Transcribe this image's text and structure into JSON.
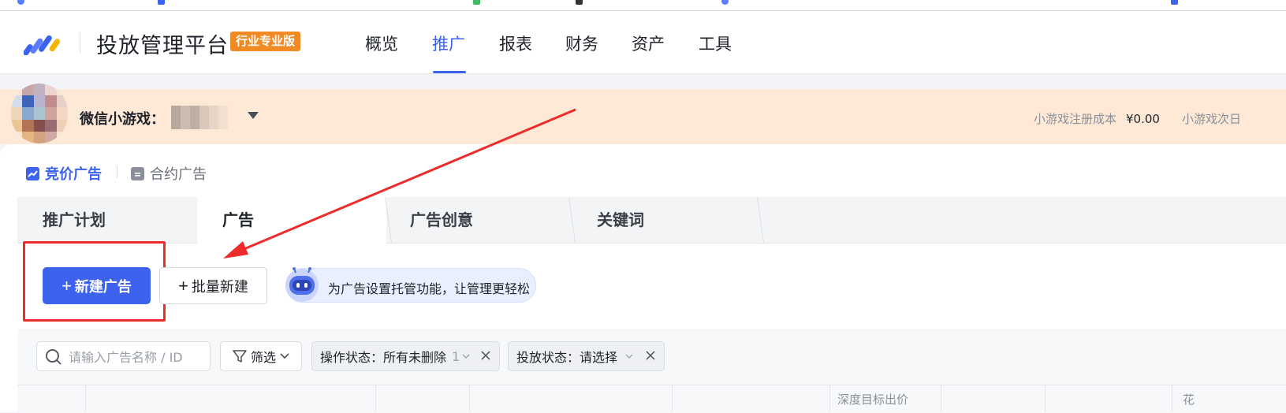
{
  "platform": {
    "title": "投放管理平台",
    "edition_badge": "行业专业版"
  },
  "nav": {
    "items": [
      {
        "label": "概览"
      },
      {
        "label": "推广"
      },
      {
        "label": "报表"
      },
      {
        "label": "财务"
      },
      {
        "label": "资产"
      },
      {
        "label": "工具"
      }
    ],
    "active": "推广"
  },
  "account": {
    "label": "微信小游戏：",
    "metrics": [
      {
        "label": "小游戏注册成本",
        "value": "¥0.00"
      },
      {
        "label": "小游戏次日",
        "value": ""
      }
    ]
  },
  "ad_type": {
    "bidding": "竞价广告",
    "contract": "合约广告"
  },
  "tabs": [
    {
      "label": "推广计划"
    },
    {
      "label": "广告"
    },
    {
      "label": "广告创意"
    },
    {
      "label": "关键词"
    }
  ],
  "actions": {
    "new_ad": "新建广告",
    "batch_new": "批量新建",
    "assistant_tip": "为广告设置托管功能，让管理更轻松"
  },
  "filters": {
    "search_placeholder": "请输入广告名称 / ID",
    "filter_label": "筛选",
    "chips": [
      {
        "label": "操作状态：",
        "value": "所有未删除",
        "extra": "1"
      },
      {
        "label": "投放状态：",
        "value": "请选择"
      }
    ]
  },
  "table": {
    "partial_headers": [
      "深度目标出价",
      "花"
    ]
  },
  "colors": {
    "brand_blue": "#3c62ee",
    "badge_orange": "#f08a24",
    "banner_bg": "#fde9d6",
    "annotation_red": "#ee2b2b"
  },
  "icons": {
    "logo": "brand-logo-stripes",
    "dropdown": "caret-down-icon",
    "bidding": "trend-chart-icon",
    "contract": "document-icon",
    "search": "search-icon",
    "filter": "funnel-icon",
    "chevron": "chevron-down-icon",
    "close": "close-icon",
    "assistant": "robot-icon"
  }
}
